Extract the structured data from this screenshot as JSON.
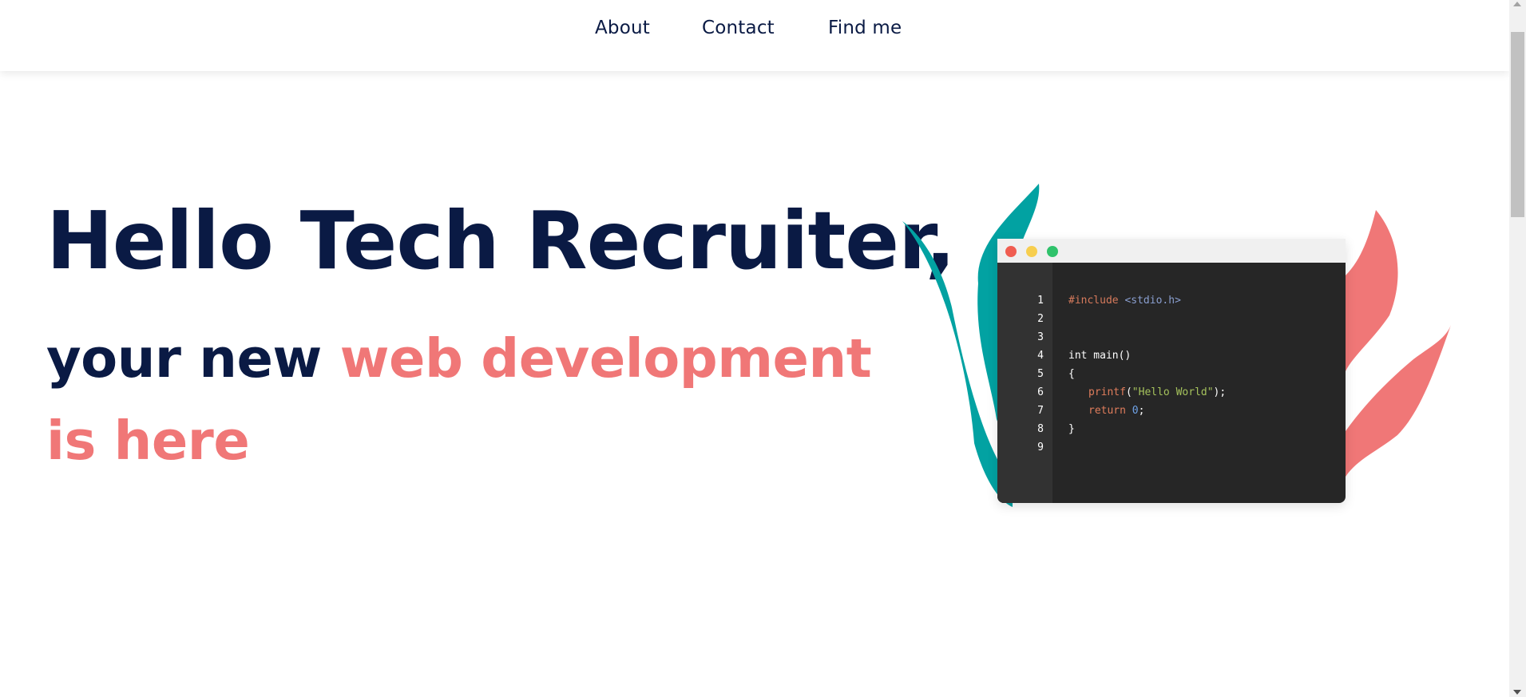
{
  "nav": {
    "links": [
      {
        "label": "About"
      },
      {
        "label": "Contact"
      },
      {
        "label": "Find me"
      }
    ]
  },
  "hero": {
    "title": "Hello Tech Recruiter,",
    "subtitle_plain": "your new ",
    "subtitle_accent": "web development is here"
  },
  "code_window": {
    "line_numbers": [
      "1",
      "2",
      "3",
      "4",
      "5",
      "6",
      "7",
      "8",
      "9"
    ],
    "lines": {
      "include_directive": "#include",
      "include_header": "<stdio.h>",
      "main_signature": "int main()",
      "open_brace": "{",
      "printf_call": "printf",
      "printf_open": "(",
      "printf_string": "\"Hello World\"",
      "printf_close": ");",
      "return_keyword": "return",
      "return_value": "0",
      "return_semicolon": ";",
      "close_brace": "}"
    }
  },
  "colors": {
    "navy": "#0a1a44",
    "coral": "#f07777",
    "teal": "#02a2a2",
    "code_bg": "#262626",
    "gutter_bg": "#323232",
    "dot_red": "#f05d51",
    "dot_yellow": "#f7ce4e",
    "dot_green": "#2fc26b"
  }
}
